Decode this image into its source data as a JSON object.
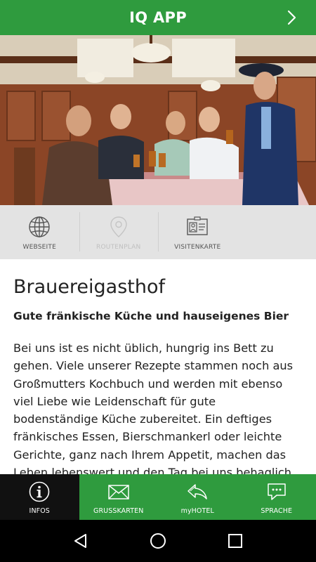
{
  "app_bar": {
    "title": "IQ APP",
    "next_icon": "chevron-right-icon",
    "color": "#2f9b3e"
  },
  "hero": {
    "icon": "photo-restaurant-guests"
  },
  "quick_links": [
    {
      "label": "WEBSEITE",
      "icon": "globe-icon",
      "enabled": true
    },
    {
      "label": "ROUTENPLAN",
      "icon": "map-pin-icon",
      "enabled": false
    },
    {
      "label": "VISITENKARTE",
      "icon": "contact-card-icon",
      "enabled": true
    }
  ],
  "content": {
    "title": "Brauereigasthof",
    "subtitle": "Gute fränkische Küche und hauseigenes Bier",
    "body": "Bei uns ist es nicht üblich, hungrig ins Bett zu gehen. Viele unserer Rezepte stammen noch aus Großmutters Kochbuch und werden mit ebenso viel Liebe wie Leidenschaft für gute bodenständige Küche zubereitet. Ein deftiges fränkisches Essen, Bierschmankerl oder leichte Gerichte, ganz nach Ihrem Appetit, machen das Leben lebenswert und den Tag bei uns behaglich."
  },
  "tabs": [
    {
      "label": "INFOS",
      "icon": "info-icon",
      "active": true
    },
    {
      "label": "GRUSSKARTEN",
      "icon": "envelope-icon",
      "active": false
    },
    {
      "label": "myHOTEL",
      "icon": "reply-arrow-icon",
      "active": false
    },
    {
      "label": "SPRACHE",
      "icon": "chat-bubble-icon",
      "active": false
    }
  ],
  "system_nav": {
    "back_icon": "back-triangle-icon",
    "home_icon": "home-circle-icon",
    "recents_icon": "recents-square-icon"
  }
}
